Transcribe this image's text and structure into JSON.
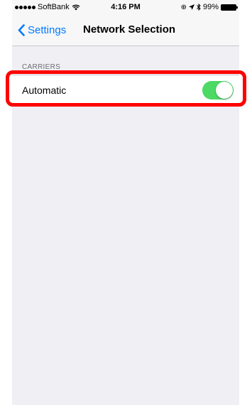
{
  "status_bar": {
    "carrier": "SoftBank",
    "time": "4:16 PM",
    "battery": "99%"
  },
  "nav": {
    "back_label": "Settings",
    "title": "Network Selection"
  },
  "section": {
    "header": "CARRIERS"
  },
  "rows": [
    {
      "label": "Automatic",
      "toggle_on": true
    }
  ],
  "colors": {
    "accent": "#007aff",
    "toggle_on": "#4cd964",
    "highlight": "#ff0000",
    "background": "#efeff4"
  },
  "icons": {
    "back": "chevron-left-icon",
    "wifi": "wifi-icon",
    "location": "location-arrow-icon",
    "bluetooth": "bluetooth-icon",
    "battery": "battery-icon"
  }
}
